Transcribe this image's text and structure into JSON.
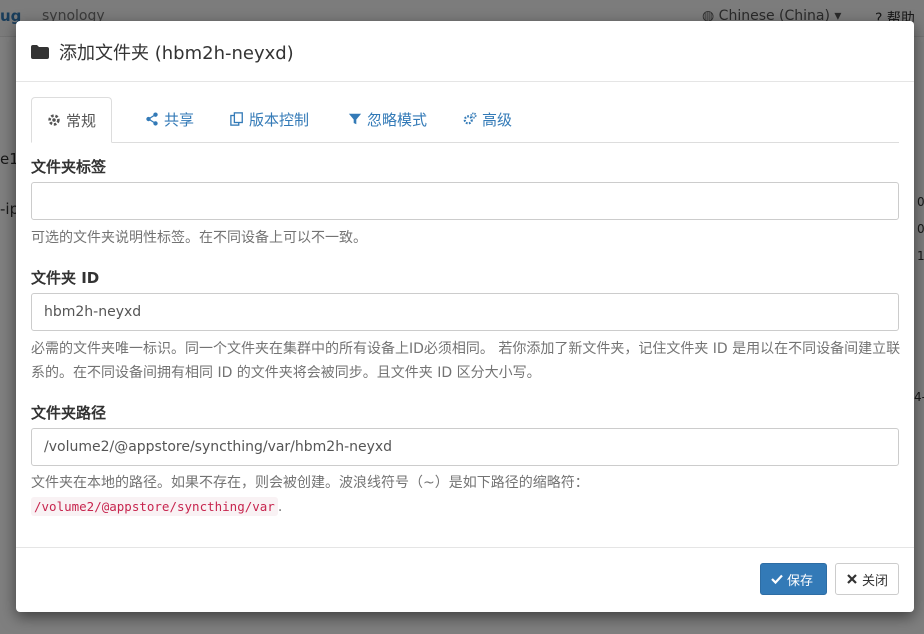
{
  "background": {
    "brand": "ug",
    "brand_secondary": "synology",
    "language": "Chinese (China)",
    "help": "帮助",
    "fragments": [
      "e1",
      "-ip",
      "0",
      "0",
      "1",
      "4-"
    ]
  },
  "modal": {
    "title": "添加文件夹 (hbm2h-neyxd)",
    "tabs": [
      {
        "label": "常规",
        "icon": "gear-icon"
      },
      {
        "label": "共享",
        "icon": "share-icon"
      },
      {
        "label": "版本控制",
        "icon": "copy-icon"
      },
      {
        "label": "忽略模式",
        "icon": "filter-icon"
      },
      {
        "label": "高级",
        "icon": "cogs-icon"
      }
    ],
    "fields": {
      "label": {
        "label": "文件夹标签",
        "value": "",
        "help": "可选的文件夹说明性标签。在不同设备上可以不一致。"
      },
      "id": {
        "label": "文件夹 ID",
        "value": "hbm2h-neyxd",
        "help": "必需的文件夹唯一标识。同一个文件夹在集群中的所有设备上ID必须相同。 若你添加了新文件夹，记住文件夹 ID 是用以在不同设备间建立联系的。在不同设备间拥有相同 ID 的文件夹将会被同步。且文件夹 ID 区分大小写。"
      },
      "path": {
        "label": "文件夹路径",
        "value": "/volume2/@appstore/syncthing/var/hbm2h-neyxd",
        "help": "文件夹在本地的路径。如果不存在，则会被创建。波浪线符号（~）是如下路径的缩略符：",
        "help_code": "/volume2/@appstore/syncthing/var",
        "help_end": "."
      }
    },
    "buttons": {
      "save": "保存",
      "close": "关闭"
    },
    "colors": {
      "primary": "#337ab7",
      "code_text": "#c7254e",
      "code_bg": "#f9f2f4"
    }
  }
}
